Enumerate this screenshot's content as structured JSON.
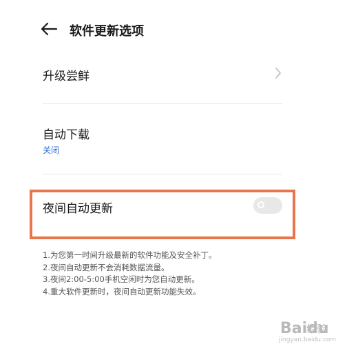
{
  "header": {
    "title": "软件更新选项",
    "back_icon": "arrow-left-icon"
  },
  "rows": [
    {
      "label": "升级尝鲜",
      "icon": "chevron-right-icon"
    },
    {
      "label": "自动下载",
      "value": "关闭"
    },
    {
      "label": "夜间自动更新",
      "toggle": "off"
    }
  ],
  "notes": [
    "1.为您第一时间升级最新的软件功能及安全补丁。",
    "2.夜间自动更新不会消耗数据流量。",
    "3.夜间2:00-5:00手机空闲时为您自动更新。",
    "4.重大软件更新时，夜间自动更新功能失效。"
  ],
  "watermark": {
    "brand": "Baidu",
    "label": "经验",
    "url": "jingyan.baidu.com"
  },
  "colors": {
    "accent_link": "#2f6fd6",
    "highlight_border": "#e8764a",
    "toggle_off": "#e8e8e8"
  }
}
